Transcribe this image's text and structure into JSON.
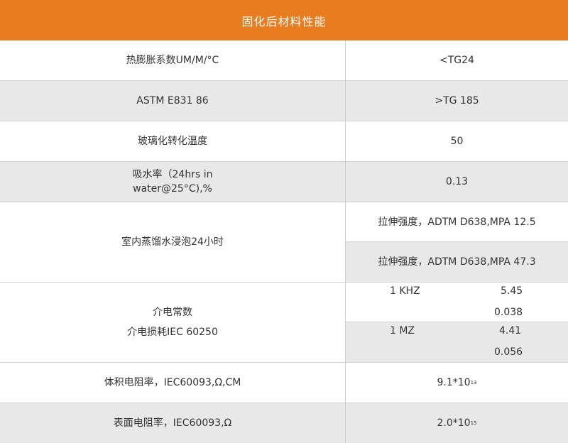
{
  "title": "固化后材料性能",
  "rows": [
    {
      "label": "热膨胀系数UM/M/°C",
      "value": "<TG24"
    },
    {
      "label": "ASTM E831 86",
      "value": ">TG 185"
    },
    {
      "label": "玻璃化转化温度",
      "value": "50"
    },
    {
      "label_line1": "吸水率（24hrs in",
      "label_line2": "water@25°C),%",
      "value": "0.13"
    },
    {
      "label": "室内蒸馏水浸泡24小时",
      "values": [
        "拉伸强度，ADTM D638,MPA 12.5",
        "拉伸强度，ADTM D638,MPA 47.3"
      ]
    },
    {
      "label_line1": "介电常数",
      "label_line2": "介电损耗IEC 60250",
      "groups": [
        {
          "freq": "1 KHZ",
          "constant": "5.45",
          "loss": "0.038"
        },
        {
          "freq": "1 MZ",
          "constant": "4.41",
          "loss": "0.056"
        }
      ]
    },
    {
      "label": "体积电阻率，IEC60093,Ω,CM",
      "value_base": "9.1*10",
      "value_exp": "13"
    },
    {
      "label": "表面电阻率，IEC60093,Ω",
      "value_base": "2.0*10",
      "value_exp": "15"
    }
  ],
  "colors": {
    "header": "#e97c1e",
    "row_gray": "#e8e8e8",
    "divider": "#d2d2d2"
  }
}
